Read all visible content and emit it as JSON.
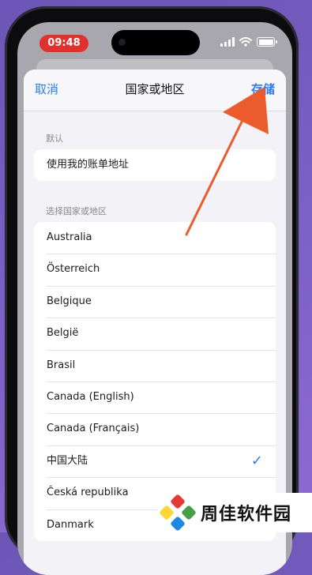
{
  "status_bar": {
    "time": "09:48",
    "icons": [
      "signal-icon",
      "wifi-icon",
      "battery-icon"
    ]
  },
  "nav": {
    "cancel_label": "取消",
    "title": "国家或地区",
    "save_label": "存储"
  },
  "sections": {
    "default_header": "默认",
    "default_row": "使用我的账单地址",
    "choose_header": "选择国家或地区"
  },
  "countries": [
    {
      "label": "Australia",
      "selected": false
    },
    {
      "label": "Österreich",
      "selected": false
    },
    {
      "label": "Belgique",
      "selected": false
    },
    {
      "label": "België",
      "selected": false
    },
    {
      "label": "Brasil",
      "selected": false
    },
    {
      "label": "Canada (English)",
      "selected": false
    },
    {
      "label": "Canada (Français)",
      "selected": false
    },
    {
      "label": "中国大陆",
      "selected": true
    },
    {
      "label": "Česká republika",
      "selected": false
    },
    {
      "label": "Danmark",
      "selected": false
    }
  ],
  "watermark": {
    "text": "周佳软件园"
  },
  "colors": {
    "accent": "#2d7cf6",
    "annotation_arrow": "#ec5b2c",
    "time_pill": "#e2302d"
  }
}
